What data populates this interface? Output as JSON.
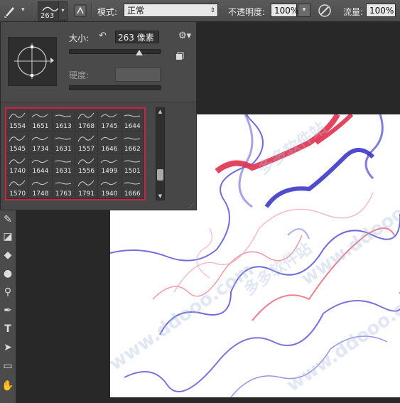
{
  "options_bar": {
    "brush_size": "263",
    "mode_label": "模式:",
    "mode_value": "正常",
    "opacity_label": "不透明度:",
    "opacity_value": "100%",
    "flow_label": "流量:",
    "flow_value": "100%"
  },
  "brush_picker": {
    "size_label": "大小:",
    "size_value": "263 像素",
    "hardness_label": "硬度:",
    "presets": [
      "1554",
      "1651",
      "1613",
      "1768",
      "1745",
      "1644",
      "1545",
      "1734",
      "1631",
      "1557",
      "1646",
      "1662",
      "1740",
      "1644",
      "1631",
      "1556",
      "1499",
      "1501",
      "1570",
      "1748",
      "1763",
      "1791",
      "1940",
      "1666"
    ]
  },
  "canvas": {
    "watermark_text": "多多软件站",
    "watermark_url": "www.ddooo.com"
  },
  "colors": {
    "accent_red": "#d02040",
    "stroke_blue": "#4b46d0",
    "stroke_red": "#e0304c"
  }
}
